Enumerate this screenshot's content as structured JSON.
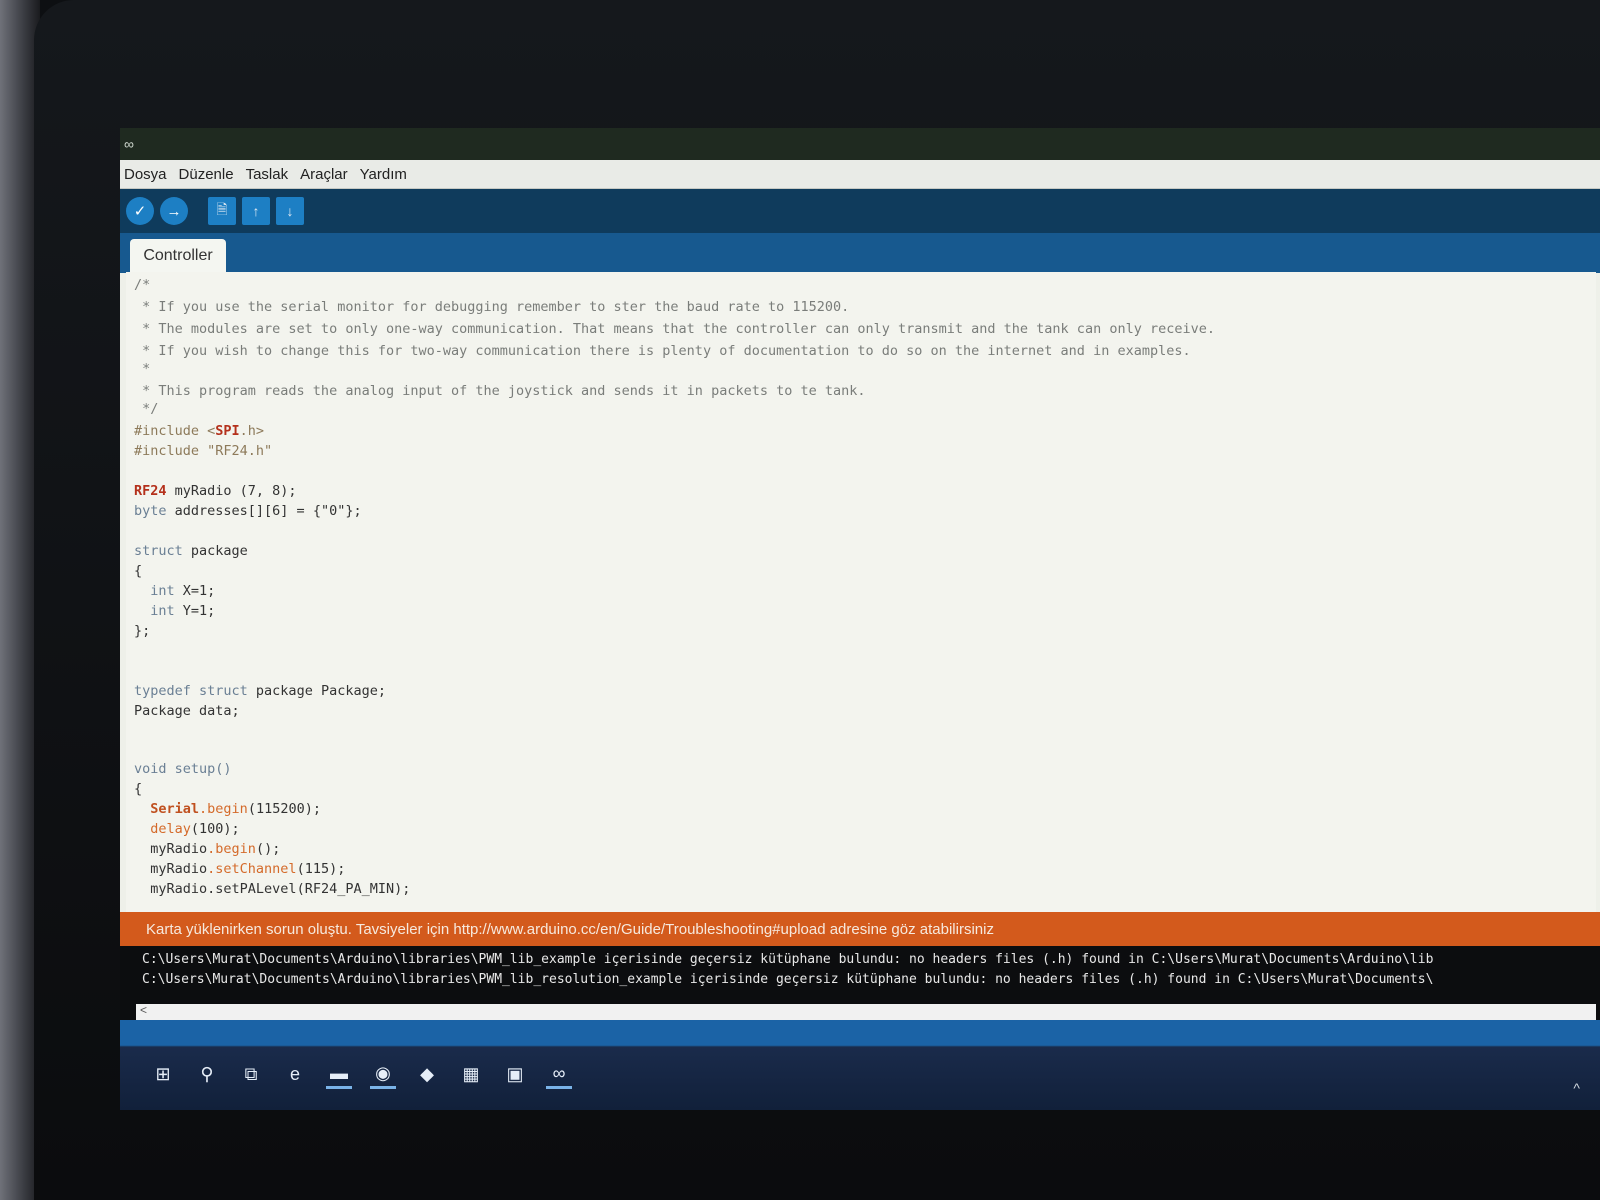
{
  "window": {
    "app_icon": "∞"
  },
  "menu": [
    "Dosya",
    "Düzenle",
    "Taslak",
    "Araçlar",
    "Yardım"
  ],
  "toolbar": {
    "verify_icon": "✓",
    "upload_icon": "→",
    "new_icon": "🗎",
    "open_icon": "↑",
    "save_icon": "↓"
  },
  "tab": {
    "label": "Controller"
  },
  "code": {
    "l1": "/*",
    "l2": " * If you use the serial monitor for debugging remember to ster the baud rate to 115200.",
    "l3": " * The modules are set to only one-way communication. That means that the controller can only transmit and the tank can only receive.",
    "l4": " * If you wish to change this for two-way communication there is plenty of documentation to do so on the internet and in examples.",
    "l5": " *",
    "l6": " * This program reads the analog input of the joystick and sends it in packets to te tank.",
    "l7": " */",
    "l8_pre": "#include <",
    "l8_lib": "SPI",
    "l8_post": ".h>",
    "l9": "#include \"RF24.h\"",
    "l10_cls": "RF24",
    "l10_rest": " myRadio (7, 8);",
    "l11_kw": "byte",
    "l11_rest": " addresses[][6] = {\"0\"};",
    "l12_kw": "struct",
    "l12_rest": " package",
    "l13": "{",
    "l14_kw": "  int",
    "l14_rest": " X=1;",
    "l15_kw": "  int",
    "l15_rest": " Y=1;",
    "l16": "};",
    "l17_kw": "typedef struct",
    "l17_rest": " package Package;",
    "l18": "Package data;",
    "l19_kw": "void",
    "l19_fn": " setup",
    "l19_rest": "()",
    "l20": "{",
    "l21_cls": "  Serial",
    "l21_fn": ".begin",
    "l21_rest": "(115200);",
    "l22_fn": "  delay",
    "l22_rest": "(100);",
    "l23_pre": "  myRadio",
    "l23_fn": ".begin",
    "l23_rest": "();",
    "l24_pre": "  myRadio",
    "l24_fn": ".setChannel",
    "l24_rest": "(115);",
    "l25_pre": "  myRadio",
    "l25_fn": ".setPALevel",
    "l25_rest": "(RF24_PA_MIN);"
  },
  "console": {
    "error": "Karta yüklenirken sorun oluştu. Tavsiyeler için http://www.arduino.cc/en/Guide/Troubleshooting#upload adresine göz atabilirsiniz",
    "line1": "C:\\Users\\Murat\\Documents\\Arduino\\libraries\\PWM_lib_example içerisinde geçersiz kütüphane bulundu: no headers files (.h) found in C:\\Users\\Murat\\Documents\\Arduino\\lib",
    "line2": "C:\\Users\\Murat\\Documents\\Arduino\\libraries\\PWM_lib_resolution_example içerisinde geçersiz kütüphane bulundu: no headers files (.h) found in C:\\Users\\Murat\\Documents\\",
    "scroll_left": "<"
  },
  "taskbar": {
    "start_icon": "⊞",
    "search_icon": "⚲",
    "taskview_icon": "⧉",
    "edge_icon": "e",
    "explorer_icon": "▬",
    "chrome_icon": "◉",
    "app1_icon": "◆",
    "app2_icon": "▦",
    "app3_icon": "▣",
    "arduino_icon": "∞",
    "tray_icon": "^"
  }
}
